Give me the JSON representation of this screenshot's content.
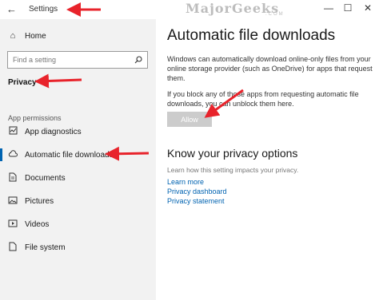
{
  "titlebar": {
    "title": "Settings",
    "watermark": "MajorGeeks",
    "watermark_sub": ".COM",
    "minimize": "—",
    "maximize": "☐",
    "close": "✕"
  },
  "sidebar": {
    "home_label": "Home",
    "search_placeholder": "Find a setting",
    "section_title": "Privacy",
    "group_title": "App permissions",
    "items": [
      {
        "label": "App diagnostics",
        "icon": "app-diagnostics-icon"
      },
      {
        "label": "Automatic file downloads",
        "icon": "cloud-icon",
        "selected": true
      },
      {
        "label": "Documents",
        "icon": "document-icon"
      },
      {
        "label": "Pictures",
        "icon": "picture-icon"
      },
      {
        "label": "Videos",
        "icon": "video-icon"
      },
      {
        "label": "File system",
        "icon": "file-system-icon"
      }
    ]
  },
  "main": {
    "title": "Automatic file downloads",
    "description": "Windows can automatically download online-only files from your online storage provider (such as OneDrive) for apps that request them.",
    "unblock_text": "If you block any of those apps from requesting automatic file downloads, you can unblock them here.",
    "allow_label": "Allow",
    "privacy_title": "Know your privacy options",
    "privacy_sub": "Learn how this setting impacts your privacy.",
    "links": [
      "Learn more",
      "Privacy dashboard",
      "Privacy statement"
    ]
  },
  "colors": {
    "accent": "#0063b1",
    "annotation_arrow": "#e8232b",
    "sidebar_bg": "#f2f2f2"
  }
}
